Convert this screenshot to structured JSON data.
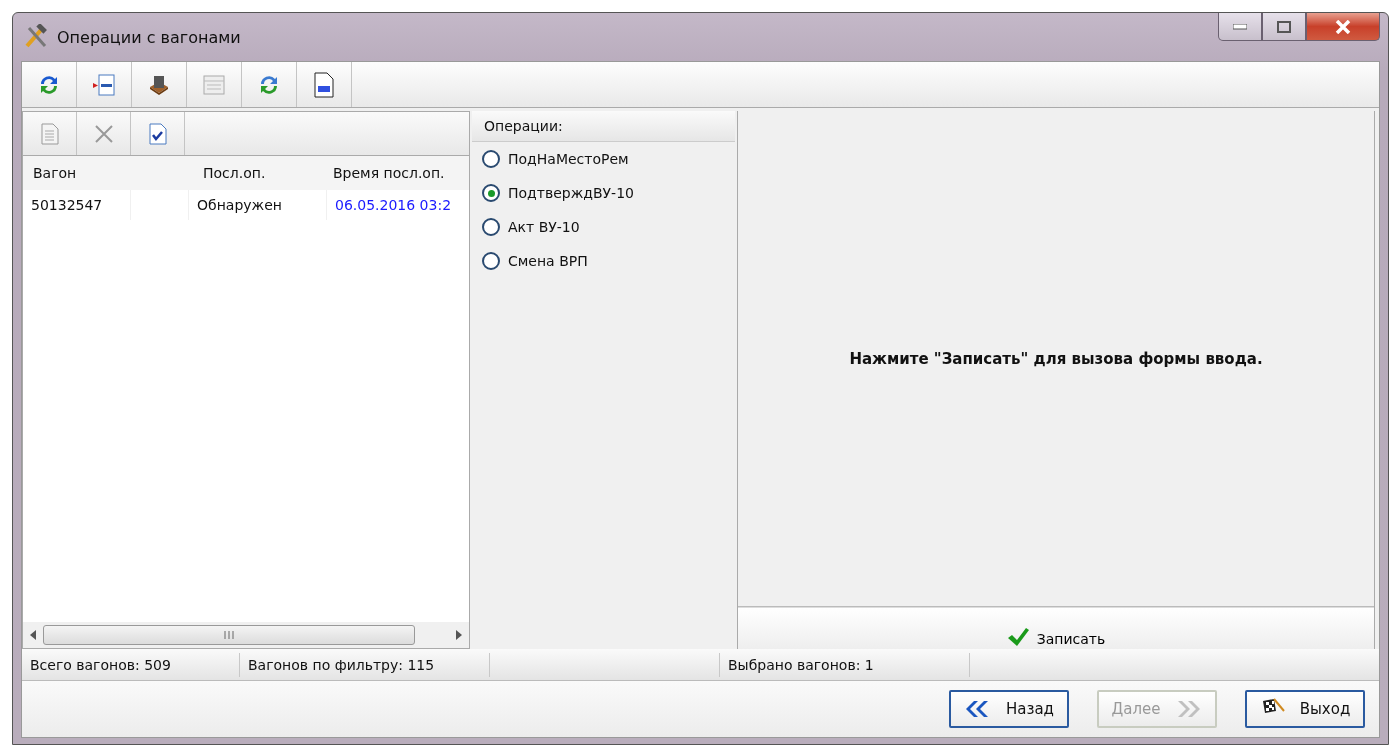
{
  "window": {
    "title": "Операции с вагонами"
  },
  "table": {
    "columns": [
      "Вагон",
      "Посл.оп.",
      "Время посл.оп."
    ],
    "rows": [
      {
        "cells": [
          "50132547",
          "Обнаружен",
          "06.05.2016 03:2"
        ],
        "selected": false
      }
    ]
  },
  "operations": {
    "title": "Операции:",
    "items": [
      {
        "label": "ПодНаМестоРем",
        "selected": false
      },
      {
        "label": "ПодтверждВУ-10",
        "selected": true
      },
      {
        "label": "Акт ВУ-10",
        "selected": false
      },
      {
        "label": "Смена ВРП",
        "selected": false
      }
    ]
  },
  "hint": "Нажмите \"Записать\" для вызова формы ввода.",
  "save_button": "Записать",
  "status_bar": [
    "Всего вагонов: 509",
    "Вагонов по фильтру: 115",
    "Выбрано вагонов: 1"
  ],
  "nav_buttons": [
    {
      "label": "Назад",
      "kind": "back",
      "disabled": false
    },
    {
      "label": "Далее",
      "kind": "next",
      "disabled": true
    },
    {
      "label": "Выход",
      "kind": "exit",
      "disabled": false
    }
  ]
}
